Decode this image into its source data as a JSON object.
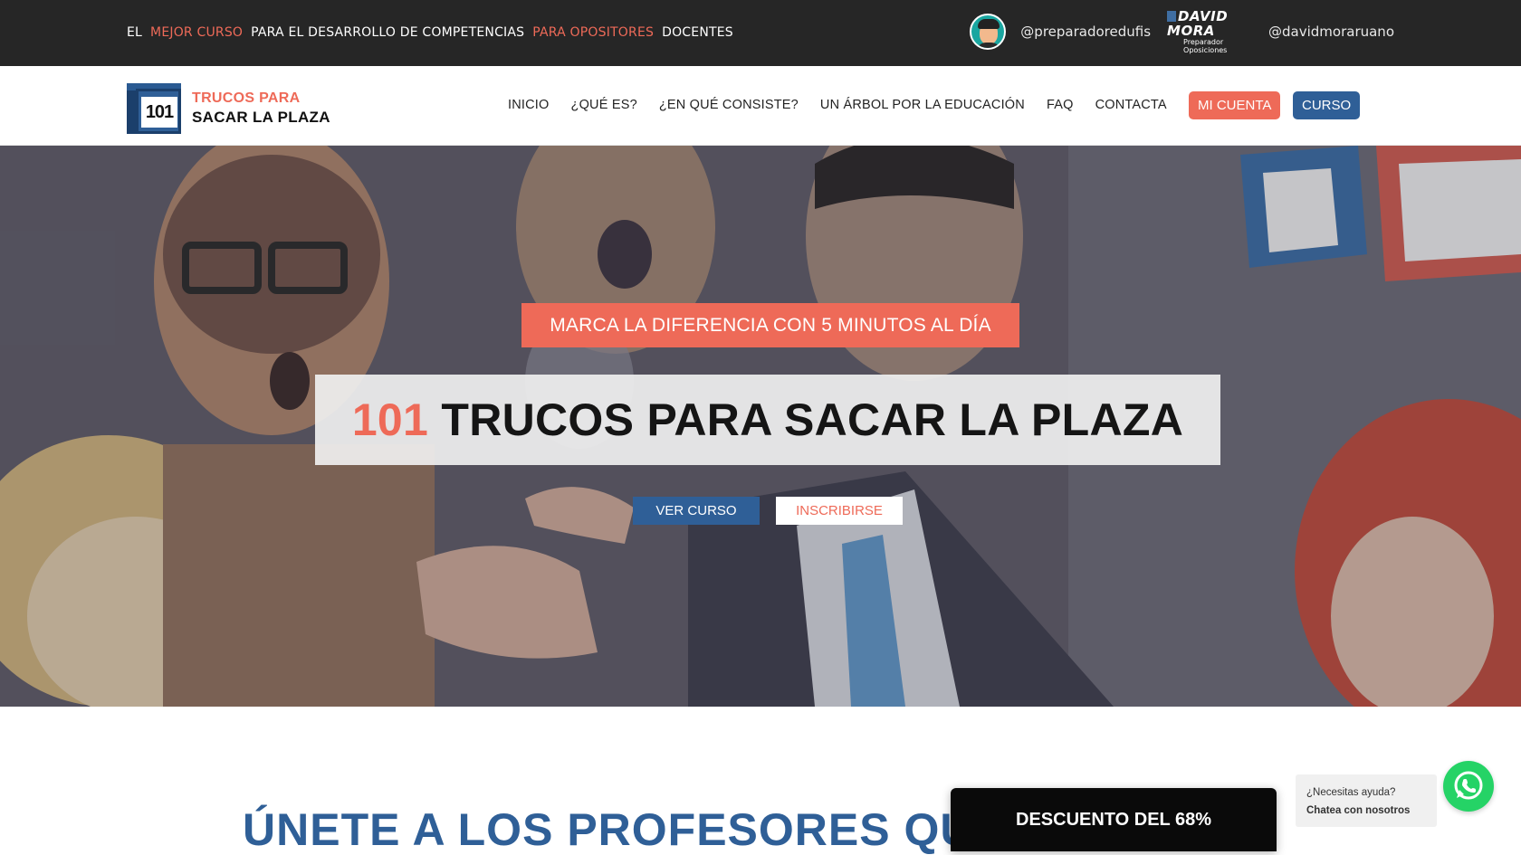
{
  "topbar": {
    "tagline": [
      {
        "text": "EL",
        "highlight": false
      },
      {
        "text": "MEJOR CURSO",
        "highlight": true
      },
      {
        "text": "PARA EL DESARROLLO DE COMPETENCIAS",
        "highlight": false
      },
      {
        "text": "PARA OPOSITORES",
        "highlight": true
      },
      {
        "text": "DOCENTES",
        "highlight": false
      }
    ],
    "social": {
      "avatar_icon": "avatar-icon",
      "handle_1": "@preparadoredufis",
      "dm_logo_title": "DAVID MORA",
      "dm_logo_sub": "Preparador Oposiciones",
      "handle_2": "@davidmoraruano"
    }
  },
  "header": {
    "logo": {
      "number": "101",
      "line1": "TRUCOS PARA",
      "line2": "SACAR LA PLAZA"
    },
    "nav": [
      "INICIO",
      "¿QUÉ ES?",
      "¿EN QUÉ CONSISTE?",
      "UN ÁRBOL POR LA EDUCACIÓN",
      "FAQ",
      "CONTACTA"
    ],
    "account_label": "MI CUENTA",
    "curso_label": "CURSO"
  },
  "hero": {
    "kicker": "MARCA LA DIFERENCIA CON 5 MINUTOS AL DÍA",
    "title_number": "101",
    "title_rest": " TRUCOS PARA SACAR LA PLAZA",
    "btn_ver": "VER CURSO",
    "btn_ins": "INSCRIBIRSE"
  },
  "section": {
    "heading": "ÚNETE A LOS PROFESORES QUE",
    "discount": "DESCUENTO DEL 68%"
  },
  "chat": {
    "question": "¿Necesitas ayuda?",
    "cta": "Chatea con nosotros",
    "icon": "whatsapp-icon"
  },
  "colors": {
    "accent": "#ee6a58",
    "brand_blue": "#2f5f97",
    "topbar_bg": "#262626",
    "whatsapp": "#25d366"
  }
}
